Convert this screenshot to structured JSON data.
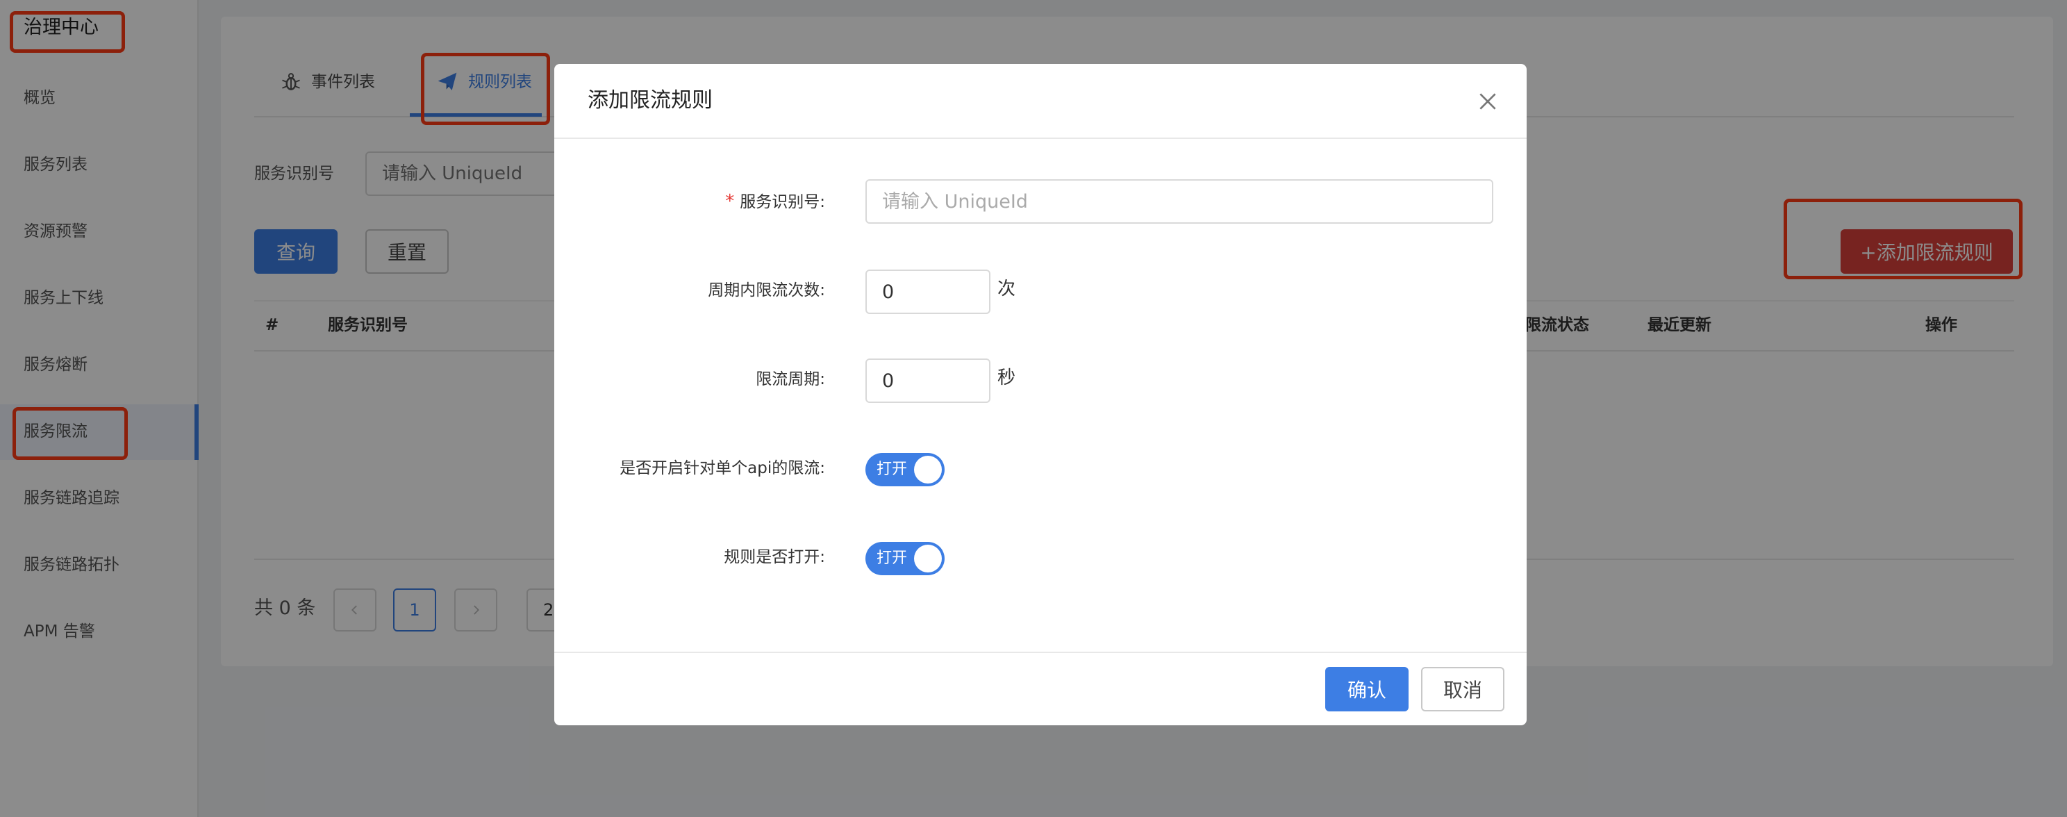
{
  "sidebar": {
    "brand": "治理中心",
    "items": [
      "概览",
      "服务列表",
      "资源预警",
      "服务上下线",
      "服务熔断",
      "服务限流",
      "服务链路追踪",
      "服务链路拓扑",
      "APM 告警"
    ],
    "active_item": "服务限流"
  },
  "tabs": [
    {
      "label": "事件列表",
      "icon": "bug-icon"
    },
    {
      "label": "规则列表",
      "icon": "paper-plane-icon"
    }
  ],
  "active_tab": "规则列表",
  "filter": {
    "label": "服务识别号",
    "placeholder": "请输入 UniqueId",
    "query_button": "查询",
    "reset_button": "重置",
    "add_button": "+添加限流规则"
  },
  "table": {
    "columns": [
      "#",
      "服务识别号",
      "限流状态",
      "最近更新",
      "操作"
    ],
    "rows": []
  },
  "pagination": {
    "total_text": "共 0 条",
    "current_page": "1",
    "page_size_partial": "2"
  },
  "modal": {
    "title": "添加限流规则",
    "fields": {
      "service_id_label": "服务识别号:",
      "service_id_placeholder": "请输入 UniqueId",
      "limit_count_label": "周期内限流次数:",
      "limit_count_value": "0",
      "limit_count_unit": "次",
      "limit_period_label": "限流周期:",
      "limit_period_value": "0",
      "limit_period_unit": "秒",
      "per_api_label": "是否开启针对单个api的限流:",
      "per_api_switch": "打开",
      "rule_enabled_label": "规则是否打开:",
      "rule_enabled_switch": "打开"
    },
    "confirm_button": "确认",
    "cancel_button": "取消"
  },
  "colors": {
    "primary": "#3d7ee4",
    "danger": "#d9413b",
    "annotation": "#ff3b14",
    "required": "#e53935"
  }
}
